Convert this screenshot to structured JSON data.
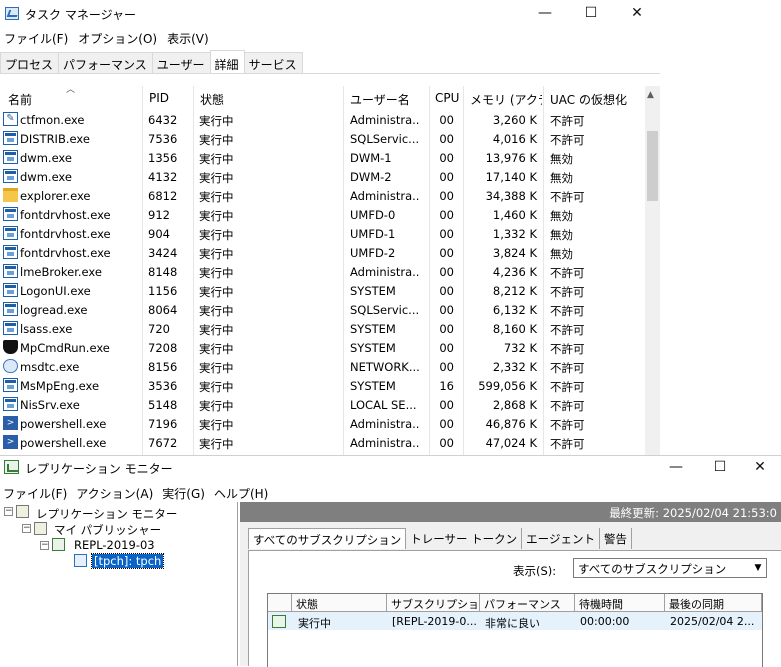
{
  "task_manager": {
    "title": "タスク マネージャー",
    "window_buttons": {
      "minimize": "—",
      "maximize": "☐",
      "close": "✕"
    },
    "menu": [
      "ファイル(F)",
      "オプション(O)",
      "表示(V)"
    ],
    "tabs": [
      "プロセス",
      "パフォーマンス",
      "ユーザー",
      "詳細",
      "サービス"
    ],
    "active_tab": "詳細",
    "columns": [
      "名前",
      "PID",
      "状態",
      "ユーザー名",
      "CPU",
      "メモリ (アクテ...",
      "UAC の仮想化"
    ],
    "processes": [
      {
        "name": "ctfmon.exe",
        "pid": "6432",
        "status": "実行中",
        "user": "Administra...",
        "cpu": "00",
        "mem": "3,260 K",
        "uac": "不許可",
        "icon": "edit-icon"
      },
      {
        "name": "DISTRIB.exe",
        "pid": "7536",
        "status": "実行中",
        "user": "SQLServic...",
        "cpu": "00",
        "mem": "4,016 K",
        "uac": "不許可",
        "icon": "window-icon"
      },
      {
        "name": "dwm.exe",
        "pid": "1356",
        "status": "実行中",
        "user": "DWM-1",
        "cpu": "00",
        "mem": "13,976 K",
        "uac": "無効",
        "icon": "window-icon"
      },
      {
        "name": "dwm.exe",
        "pid": "4132",
        "status": "実行中",
        "user": "DWM-2",
        "cpu": "00",
        "mem": "17,140 K",
        "uac": "無効",
        "icon": "window-icon"
      },
      {
        "name": "explorer.exe",
        "pid": "6812",
        "status": "実行中",
        "user": "Administra...",
        "cpu": "00",
        "mem": "34,388 K",
        "uac": "不許可",
        "icon": "folder-icon"
      },
      {
        "name": "fontdrvhost.exe",
        "pid": "912",
        "status": "実行中",
        "user": "UMFD-0",
        "cpu": "00",
        "mem": "1,460 K",
        "uac": "無効",
        "icon": "window-icon"
      },
      {
        "name": "fontdrvhost.exe",
        "pid": "904",
        "status": "実行中",
        "user": "UMFD-1",
        "cpu": "00",
        "mem": "1,332 K",
        "uac": "無効",
        "icon": "window-icon"
      },
      {
        "name": "fontdrvhost.exe",
        "pid": "3424",
        "status": "実行中",
        "user": "UMFD-2",
        "cpu": "00",
        "mem": "3,824 K",
        "uac": "無効",
        "icon": "window-icon"
      },
      {
        "name": "lmeBroker.exe",
        "pid": "8148",
        "status": "実行中",
        "user": "Administra...",
        "cpu": "00",
        "mem": "4,236 K",
        "uac": "不許可",
        "icon": "window-icon"
      },
      {
        "name": "LogonUI.exe",
        "pid": "1156",
        "status": "実行中",
        "user": "SYSTEM",
        "cpu": "00",
        "mem": "8,212 K",
        "uac": "不許可",
        "icon": "window-icon"
      },
      {
        "name": "logread.exe",
        "pid": "8064",
        "status": "実行中",
        "user": "SQLServic...",
        "cpu": "00",
        "mem": "6,132 K",
        "uac": "不許可",
        "icon": "window-icon"
      },
      {
        "name": "lsass.exe",
        "pid": "720",
        "status": "実行中",
        "user": "SYSTEM",
        "cpu": "00",
        "mem": "8,160 K",
        "uac": "不許可",
        "icon": "window-icon"
      },
      {
        "name": "MpCmdRun.exe",
        "pid": "7208",
        "status": "実行中",
        "user": "SYSTEM",
        "cpu": "00",
        "mem": "732 K",
        "uac": "不許可",
        "icon": "shield-icon"
      },
      {
        "name": "msdtc.exe",
        "pid": "8156",
        "status": "実行中",
        "user": "NETWORK...",
        "cpu": "00",
        "mem": "2,332 K",
        "uac": "不許可",
        "icon": "network-icon"
      },
      {
        "name": "MsMpEng.exe",
        "pid": "3536",
        "status": "実行中",
        "user": "SYSTEM",
        "cpu": "16",
        "mem": "599,056 K",
        "uac": "不許可",
        "icon": "window-icon"
      },
      {
        "name": "NisSrv.exe",
        "pid": "5148",
        "status": "実行中",
        "user": "LOCAL SE...",
        "cpu": "00",
        "mem": "2,868 K",
        "uac": "不許可",
        "icon": "window-icon"
      },
      {
        "name": "powershell.exe",
        "pid": "7196",
        "status": "実行中",
        "user": "Administra...",
        "cpu": "00",
        "mem": "46,876 K",
        "uac": "不許可",
        "icon": "powershell-icon"
      },
      {
        "name": "powershell.exe",
        "pid": "7672",
        "status": "実行中",
        "user": "Administra...",
        "cpu": "00",
        "mem": "47,024 K",
        "uac": "不許可",
        "icon": "powershell-icon"
      }
    ]
  },
  "replication_monitor": {
    "title": "レプリケーション モニター",
    "window_buttons": {
      "minimize": "—",
      "maximize": "☐",
      "close": "✕"
    },
    "menu": [
      "ファイル(F)",
      "アクション(A)",
      "実行(G)",
      "ヘルプ(H)"
    ],
    "tree": {
      "root": "レプリケーション モニター",
      "publisher": "マイ パブリッシャー",
      "publication": "REPL-2019-03",
      "subscription": "[tpch]: tpch"
    },
    "last_update": "最終更新: 2025/02/04 21:53:0",
    "tabs": [
      "すべてのサブスクリプション",
      "トレーサー トークン",
      "エージェント",
      "警告"
    ],
    "show_label": "表示(S):",
    "show_value": "すべてのサブスクリプション",
    "list_columns": [
      "",
      "状態",
      "サブスクリプション",
      "パフォーマンス",
      "待機時間",
      "最後の同期"
    ],
    "list_rows": [
      {
        "status": "実行中",
        "subscription": "[REPL-2019-0...",
        "performance": "非常に良い",
        "latency": "00:00:00",
        "last_sync": "2025/02/04 2..."
      }
    ]
  }
}
